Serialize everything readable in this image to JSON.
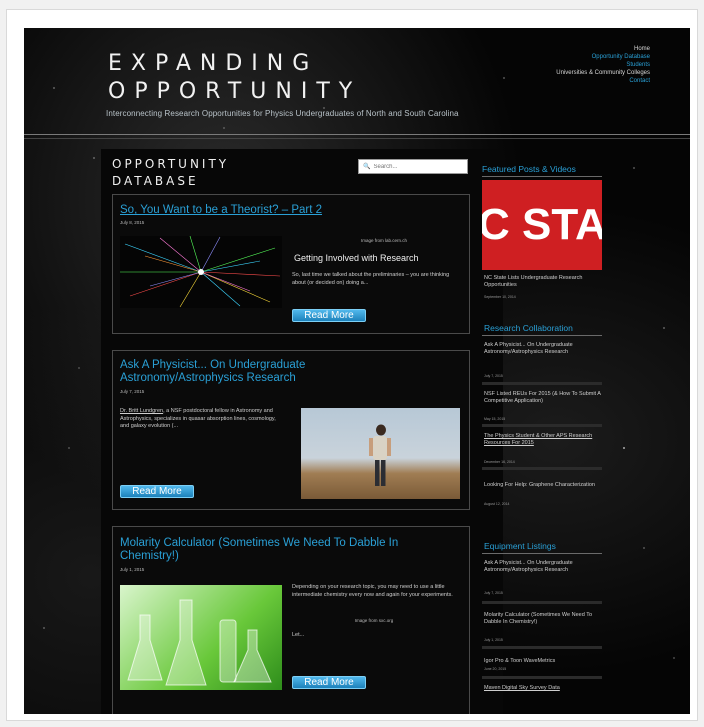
{
  "site": {
    "title_line1": "EXPANDING",
    "title_line2": "OPPORTUNITY",
    "tagline": "Interconnecting Research Opportunities for Physics Undergraduates of North and South Carolina"
  },
  "nav": {
    "items": [
      "Home",
      "Opportunity Database",
      "Students",
      "Universities & Community Colleges",
      "Contact"
    ]
  },
  "page": {
    "heading_line1": "OPPORTUNITY",
    "heading_line2": "DATABASE",
    "search_placeholder": "Search..."
  },
  "posts": [
    {
      "title": "So, You Want to be a Theorist? – Part 2",
      "date": "July 8, 2015",
      "caption": "Image from lab.cern.ch",
      "subheading": "Getting Involved with Research",
      "excerpt": "So, last time we talked about the preliminaries – you are thinking about (or decided on) doing a...",
      "button": "Read More"
    },
    {
      "title": "Ask A Physicist... On Undergraduate Astronomy/Astrophysics Research",
      "date": "July 7, 2015",
      "excerpt_link": "Dr. Britt Lundgren",
      "excerpt": ", a NSF postdoctoral fellow in Astronomy and Astrophysics, specializes in quasar absorption lines, cosmology, and galaxy evolution (...",
      "button": "Read More"
    },
    {
      "title": "Molarity Calculator (Sometimes We Need To Dabble In Chemistry!)",
      "date": "July 1, 2015",
      "excerpt": "Depending on your research topic, you may need to use a little intermediate chemistry every now and again for your experiments.",
      "caption": "Image from sxc.org",
      "excerpt2": "Let...",
      "button": "Read More"
    }
  ],
  "sidebar": {
    "featured": {
      "heading": "Featured Posts & Videos",
      "image_text": "C STAT",
      "item": "NC State Lists Undergraduate Research Opportunities",
      "date": "September 10, 2014"
    },
    "research": {
      "heading": "Research Collaboration",
      "items": [
        {
          "title": "Ask A Physicist... On Undergraduate Astronomy/Astrophysics Research",
          "date": "July 7, 2015"
        },
        {
          "title": "NSF Listed REUs For 2015 (& How To Submit A Competitive Application)",
          "date": "May 15, 2015"
        },
        {
          "title": "The Physics Student & Other APS Research Resources For 2015",
          "date": "December 16, 2014"
        },
        {
          "title": "Looking For Help: Graphene Characterization",
          "date": "August 12, 2014"
        }
      ]
    },
    "equipment": {
      "heading": "Equipment Listings",
      "items": [
        {
          "title": "Ask A Physicist... On Undergraduate Astronomy/Astrophysics Research",
          "date": "July 7, 2015"
        },
        {
          "title": "Molarity Calculator (Sometimes We Need To Dabble In Chemistry!)",
          "date": "July 1, 2015"
        },
        {
          "title": "Igor Pro & Toon WaveMetrics",
          "date": "June 20, 2015"
        },
        {
          "title": "Maven Digital Sky Survey Data",
          "date": ""
        }
      ]
    }
  },
  "colors": {
    "accent": "#2aa0d6",
    "background": "#050505",
    "button": "#2f96cf",
    "ncstate_red": "#cf1f22"
  }
}
